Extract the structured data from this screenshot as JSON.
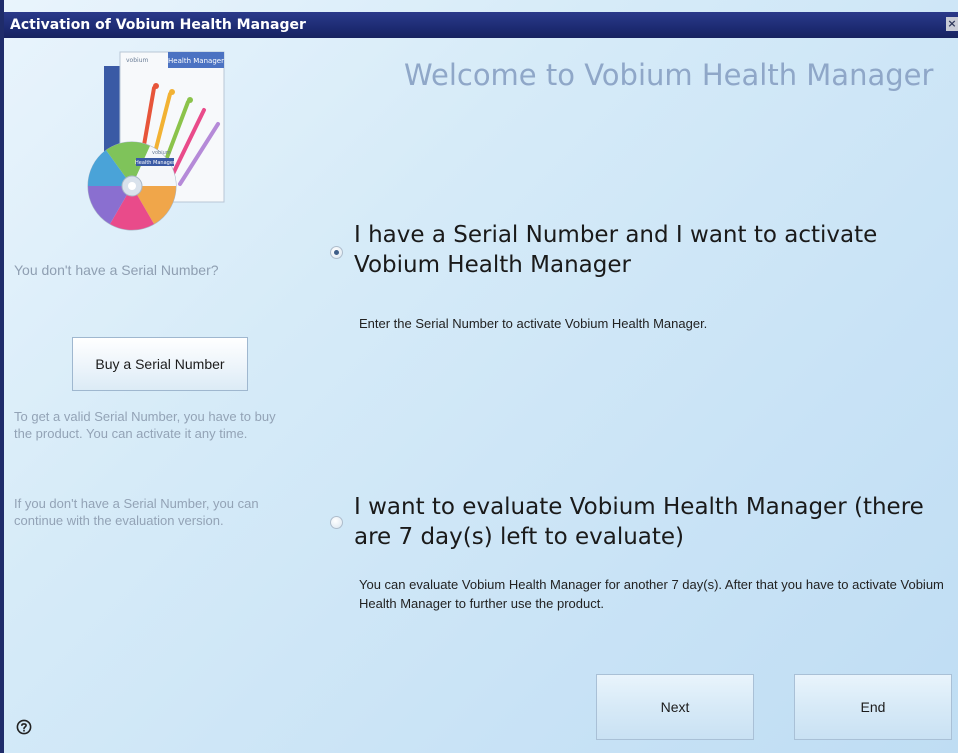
{
  "window": {
    "title": "Activation of Vobium Health Manager",
    "close_glyph": "×"
  },
  "header": {
    "welcome": "Welcome to Vobium Health Manager"
  },
  "product_image": {
    "icon": "product-box-and-cd-image",
    "box_label": "Health Manager",
    "cd_label": "Health Manager",
    "brand": "vobium"
  },
  "sidebar": {
    "question": "You don't have a Serial Number?",
    "buy_button": "Buy a Serial Number",
    "note_buy": "To get a valid Serial Number, you have to buy the product. You can activate it any time.",
    "note_eval": "If you don't have a Serial Number, you can continue with the evaluation version."
  },
  "options": [
    {
      "selected": true,
      "title": "I have a Serial Number and I want to activate Vobium Health Manager",
      "description": "Enter the Serial Number to activate Vobium Health Manager."
    },
    {
      "selected": false,
      "title": "I want to evaluate Vobium Health Manager (there are 7 day(s) left to evaluate)",
      "description": "You can evaluate Vobium Health Manager for another 7 day(s). After that you have to activate Vobium Health Manager to further use the product."
    }
  ],
  "footer": {
    "next_label": "Next",
    "end_label": "End",
    "help_icon": "help-question-icon"
  },
  "colors": {
    "titlebar": "#1d2b73",
    "welcome_text": "#8fa7c8",
    "sidebar_text": "#93a3b6",
    "background": "#cfe6f6"
  }
}
